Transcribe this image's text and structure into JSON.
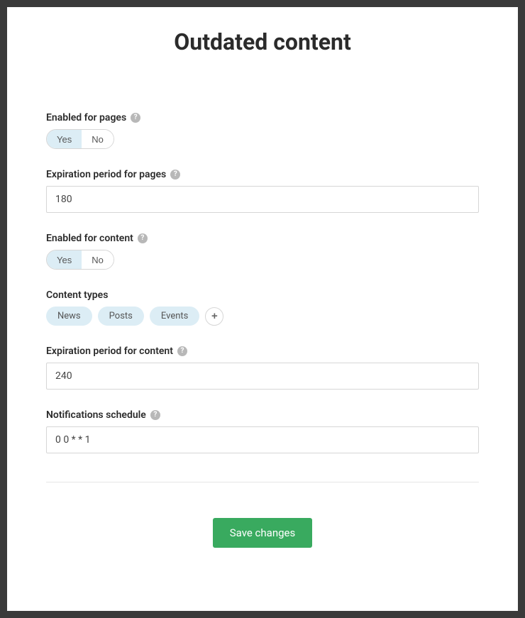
{
  "title": "Outdated content",
  "fields": {
    "enabled_pages": {
      "label": "Enabled for pages",
      "yes": "Yes",
      "no": "No",
      "value": "Yes"
    },
    "expiration_pages": {
      "label": "Expiration period for pages",
      "value": "180"
    },
    "enabled_content": {
      "label": "Enabled for content",
      "yes": "Yes",
      "no": "No",
      "value": "Yes"
    },
    "content_types": {
      "label": "Content types",
      "tags": [
        "News",
        "Posts",
        "Events"
      ]
    },
    "expiration_content": {
      "label": "Expiration period for content",
      "value": "240"
    },
    "notifications_schedule": {
      "label": "Notifications schedule",
      "value": "0 0 * * 1"
    }
  },
  "help_glyph": "?",
  "add_glyph": "+",
  "buttons": {
    "save": "Save changes"
  }
}
